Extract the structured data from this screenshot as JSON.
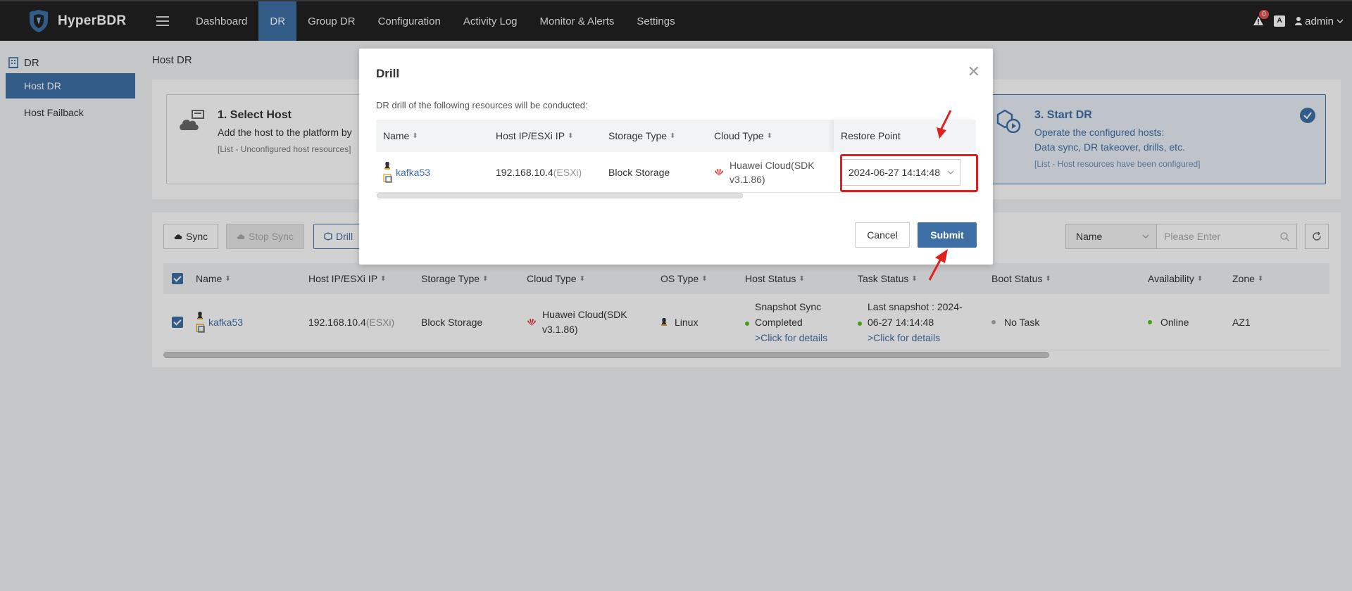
{
  "app": {
    "name": "HyperBDR"
  },
  "nav": {
    "items": [
      "Dashboard",
      "DR",
      "Group DR",
      "Configuration",
      "Activity Log",
      "Monitor & Alerts",
      "Settings"
    ],
    "active": "DR"
  },
  "topright": {
    "alert_count": "0",
    "user": "admin"
  },
  "sidebar": {
    "header": "DR",
    "items": [
      {
        "label": "Host DR",
        "active": true
      },
      {
        "label": "Host Failback",
        "active": false
      }
    ]
  },
  "page": {
    "title": "Host DR"
  },
  "steps": {
    "step1": {
      "title": "1. Select Host",
      "desc": "Add the host to the platform by",
      "note": "[List - Unconfigured host resources]"
    },
    "step3": {
      "title": "3. Start DR",
      "desc1": "Operate the configured hosts:",
      "desc2": "Data sync, DR takeover, drills, etc.",
      "note": "[List - Host resources have been configured]"
    }
  },
  "toolbar": {
    "sync": "Sync",
    "stop_sync": "Stop Sync",
    "drill": "Drill",
    "filter_field": "Name",
    "search_placeholder": "Please Enter"
  },
  "table": {
    "columns": [
      "Name",
      "Host IP/ESXi IP",
      "Storage Type",
      "Cloud Type",
      "OS Type",
      "Host Status",
      "Task Status",
      "Boot Status",
      "Availability",
      "Zone"
    ],
    "rows": [
      {
        "name": "kafka53",
        "ip": "192.168.10.4",
        "ip_suffix": "(ESXi)",
        "storage": "Block Storage",
        "cloud_line1": "Huawei Cloud(SDK",
        "cloud_line2": "v3.1.86)",
        "os": "Linux",
        "host_status_line1": "Snapshot Sync",
        "host_status_line2": "Completed",
        "host_status_link": ">Click for details",
        "task_status_line1": "Last snapshot : 2024-",
        "task_status_line2": "06-27 14:14:48",
        "task_status_link": ">Click for details",
        "boot_status": "No Task",
        "availability": "Online",
        "zone": "AZ1"
      }
    ]
  },
  "modal": {
    "title": "Drill",
    "description": "DR drill of the following resources will be conducted:",
    "columns": [
      "Name",
      "Host IP/ESXi IP",
      "Storage Type",
      "Cloud Type",
      "Restore Point"
    ],
    "row": {
      "name": "kafka53",
      "ip": "192.168.10.4",
      "ip_suffix": "(ESXi)",
      "storage": "Block Storage",
      "cloud_line1": "Huawei Cloud(SDK",
      "cloud_line2": "v3.1.86)",
      "restore_point": "2024-06-27 14:14:48"
    },
    "cancel": "Cancel",
    "submit": "Submit"
  },
  "colors": {
    "accent": "#3d6fa6",
    "topbar": "#222222",
    "highlight": "#e02020",
    "online": "#52c41a",
    "huawei": "#e02020"
  }
}
